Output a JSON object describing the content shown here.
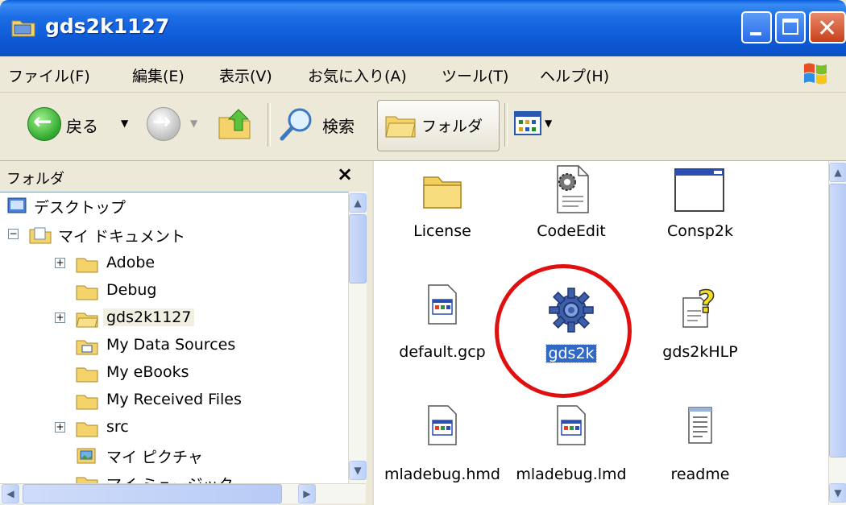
{
  "window": {
    "title": "gds2k1127"
  },
  "menu": {
    "items": [
      "ファイル(F)",
      "編集(E)",
      "表示(V)",
      "お気に入り(A)",
      "ツール(T)",
      "ヘルプ(H)"
    ]
  },
  "toolbar": {
    "back_label": "戻る",
    "search_label": "検索",
    "folders_label": "フォルダ"
  },
  "folder_pane": {
    "title": "フォルダ",
    "close_glyph": "×",
    "items": [
      {
        "label": "デスクトップ",
        "icon": "desktop-icon"
      },
      {
        "label": "マイ ドキュメント",
        "icon": "my-documents-icon",
        "expanded": true
      },
      {
        "label": "Adobe",
        "icon": "folder-icon",
        "expandable": true
      },
      {
        "label": "Debug",
        "icon": "folder-icon"
      },
      {
        "label": "gds2k1127",
        "icon": "folder-open-icon",
        "expandable": true,
        "selected": true
      },
      {
        "label": "My Data Sources",
        "icon": "data-sources-folder-icon"
      },
      {
        "label": "My eBooks",
        "icon": "folder-icon"
      },
      {
        "label": "My Received Files",
        "icon": "folder-icon"
      },
      {
        "label": "src",
        "icon": "folder-icon",
        "expandable": true
      },
      {
        "label": "マイ ピクチャ",
        "icon": "my-pictures-icon"
      },
      {
        "label": "マイ ミュージック",
        "icon": "my-music-icon"
      }
    ]
  },
  "files": [
    {
      "name": "License",
      "icon": "folder-icon"
    },
    {
      "name": "CodeEdit",
      "icon": "gear-document-icon"
    },
    {
      "name": "Consp2k",
      "icon": "app-window-icon"
    },
    {
      "name": "default.gcp",
      "icon": "window-document-icon"
    },
    {
      "name": "gds2k",
      "icon": "blue-gear-icon",
      "selected": true
    },
    {
      "name": "gds2kHLP",
      "icon": "help-file-icon"
    },
    {
      "name": "mladebug.hmd",
      "icon": "window-document-icon"
    },
    {
      "name": "mladebug.lmd",
      "icon": "window-document-icon"
    },
    {
      "name": "readme",
      "icon": "text-file-icon"
    }
  ],
  "colors": {
    "titlebar": "#0b55d6",
    "selection": "#316ac5",
    "annotation_circle": "#e01010"
  }
}
